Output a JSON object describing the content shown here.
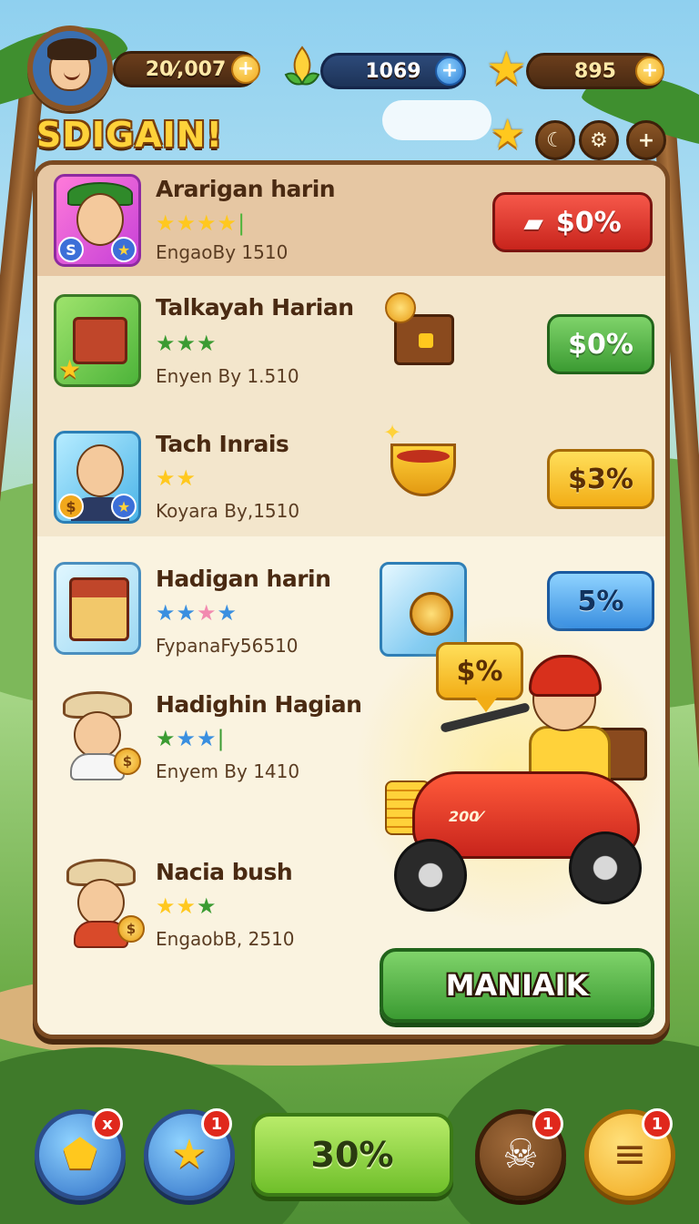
{
  "hud": {
    "coins": "20⁄,007",
    "gems": "1069",
    "stars": "895",
    "title": "SDIGAIN!"
  },
  "offers": [
    {
      "name": "Ararigan harin",
      "sub": "EngaoBy 1510",
      "price": "$0%",
      "stars": [
        "gold",
        "gold",
        "gold",
        "gold"
      ],
      "color": "red"
    },
    {
      "name": "Talkayah Harian",
      "sub": "Enyen By 1.510",
      "price": "$0%",
      "stars": [
        "green",
        "green",
        "green"
      ],
      "color": "green"
    },
    {
      "name": "Tach Inrais",
      "sub": "Koyara By,1510",
      "price": "$3%",
      "stars": [
        "gold",
        "gold"
      ],
      "color": "yellow"
    },
    {
      "name": "Hadigan harin",
      "sub": "FypanaFy56510",
      "price": "5%",
      "stars": [
        "blue",
        "blue",
        "pink",
        "blue"
      ],
      "color": "blue"
    },
    {
      "name": "Hadighin Hagian",
      "sub": "Enyem By 1410",
      "stars": [
        "green",
        "blue",
        "blue"
      ]
    },
    {
      "name": "Nacia bush",
      "sub": "EngaobB, 2510",
      "stars": [
        "gold",
        "gold",
        "green"
      ]
    }
  ],
  "bubble": "$%",
  "scooter_label": "200⁄",
  "cta": "MANIAIK",
  "bottom": {
    "badge_1": "x",
    "badge_2": "1",
    "center": "30%",
    "badge_4": "1",
    "badge_5": "1"
  },
  "colors": {
    "panel": "#f6ead2",
    "frame": "#7a4a22",
    "accent_gold": "#ffc81e",
    "cta_green": "#3b9b32"
  }
}
